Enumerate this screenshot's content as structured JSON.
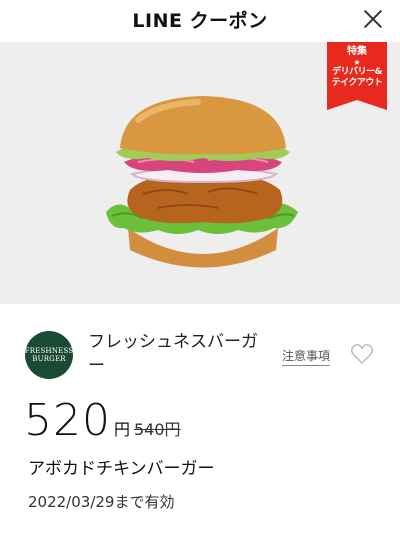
{
  "header": {
    "title": "LINE クーポン"
  },
  "badge": {
    "top": "特集",
    "star": "★",
    "line1": "デリバリー&",
    "line2": "テイクアウト"
  },
  "logo": {
    "line1": "FRESHNESS",
    "line2": "BURGER"
  },
  "brand": {
    "name": "フレッシュネスバーガー"
  },
  "notes": {
    "label": "注意事項"
  },
  "price": {
    "current": "520",
    "yen": "円",
    "original": "540円"
  },
  "product": {
    "name": "アボカドチキンバーガー"
  },
  "validity": {
    "text": "2022/03/29まで有効"
  },
  "colors": {
    "badge": "#e8291d",
    "logo_bg": "#1a4a34",
    "hero_bg": "#eeeeee"
  },
  "icons": {
    "close": "close-icon",
    "heart": "heart-icon"
  }
}
